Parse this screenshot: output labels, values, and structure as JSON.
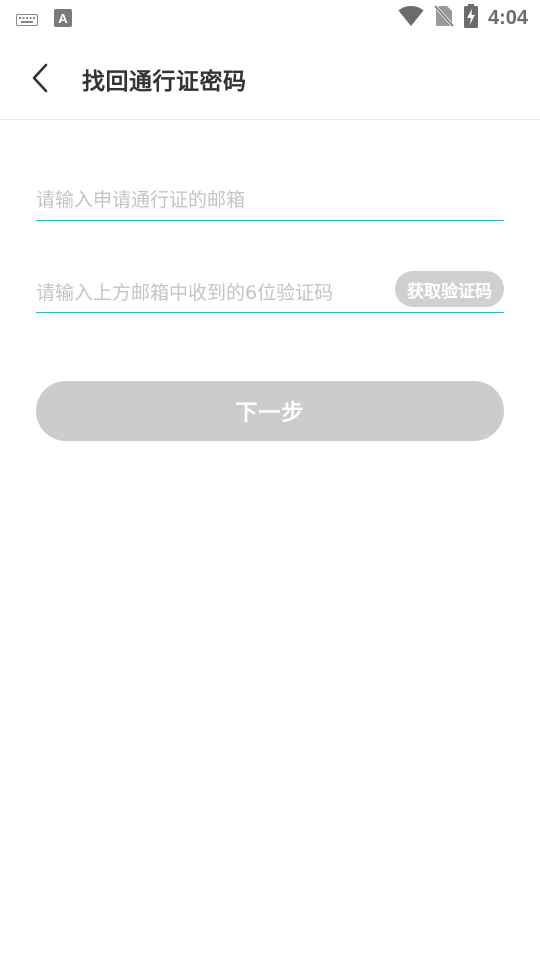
{
  "status_bar": {
    "time": "4:04",
    "keyboard_icon": "keyboard-icon",
    "a_icon": "text-a-icon",
    "wifi_icon": "wifi-icon",
    "sim_icon": "no-sim-icon",
    "battery_icon": "battery-charging-icon"
  },
  "header": {
    "title": "找回通行证密码",
    "back_icon": "chevron-left-icon"
  },
  "form": {
    "email_placeholder": "请输入申请通行证的邮箱",
    "email_value": "",
    "code_placeholder": "请输入上方邮箱中收到的6位验证码",
    "code_value": "",
    "get_code_label": "获取验证码",
    "next_label": "下一步"
  },
  "colors": {
    "accent_underline": "#2fb8c2",
    "disabled_button": "#cccccc",
    "title_text": "#333333",
    "placeholder_text": "#c4c4c4"
  }
}
